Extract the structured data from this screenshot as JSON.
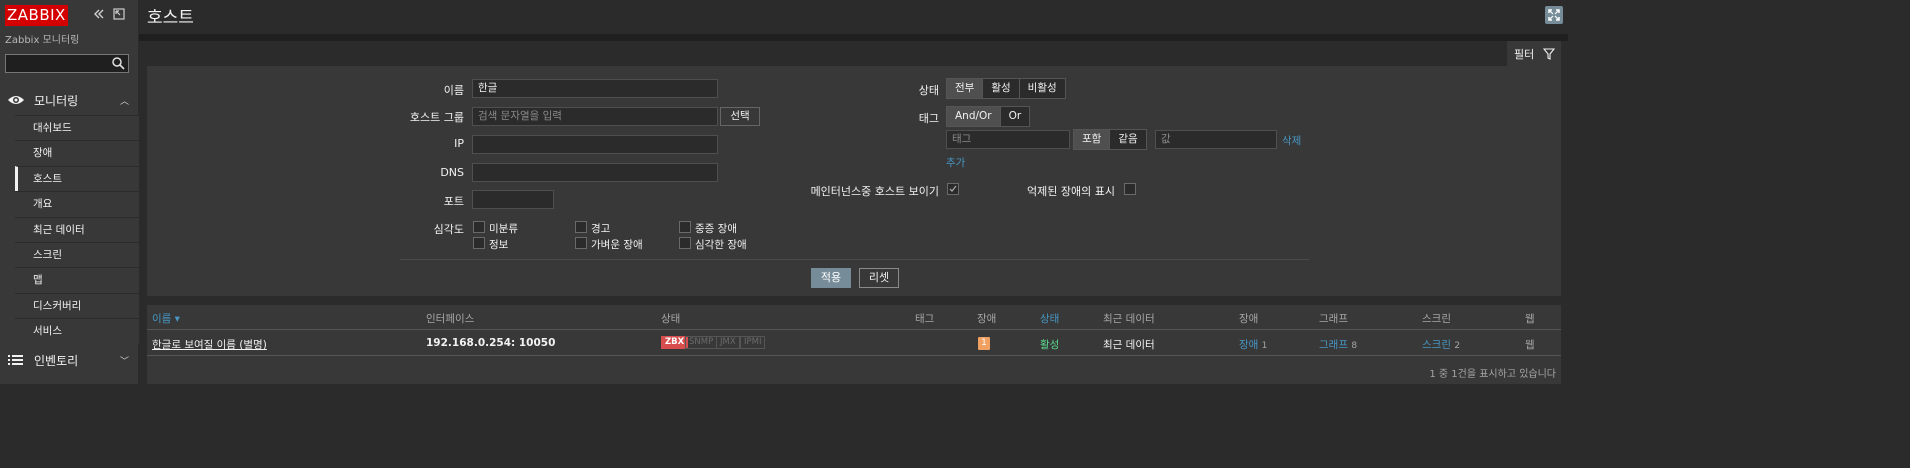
{
  "sidebar": {
    "logo": "ZABBIX",
    "server_name": "Zabbix 모니터링",
    "collapse_icon": "double-chevron-left",
    "kiosk_icon": "expand-window",
    "search_placeholder": "",
    "monitoring": {
      "label": "모니터링",
      "icon": "eye"
    },
    "submenu": [
      {
        "label": "대쉬보드"
      },
      {
        "label": "장애"
      },
      {
        "label": "호스트"
      },
      {
        "label": "개요"
      },
      {
        "label": "최근 데이터"
      },
      {
        "label": "스크린"
      },
      {
        "label": "맵"
      },
      {
        "label": "디스커버리"
      },
      {
        "label": "서비스"
      }
    ],
    "inventory": {
      "label": "인벤토리",
      "icon": "list"
    }
  },
  "header": {
    "title": "호스트",
    "fullscreen_icon": "fullscreen"
  },
  "filter": {
    "tab_label": "필터",
    "name_label": "이름",
    "name_value": "한글",
    "host_group_label": "호스트 그룹",
    "host_group_placeholder": "검색 문자열을 입력",
    "select_button": "선택",
    "ip_label": "IP",
    "dns_label": "DNS",
    "port_label": "포트",
    "severity_label": "심각도",
    "severities": [
      "미분류",
      "경고",
      "중증 장애",
      "정보",
      "가벼운 장애",
      "심각한 장애"
    ],
    "status_label": "상태",
    "status_options": [
      "전부",
      "활성",
      "비활성"
    ],
    "tags_label": "태그",
    "tag_ops": [
      "And/Or",
      "Or"
    ],
    "tag_placeholder": "태그",
    "tag_match": [
      "포함",
      "같음"
    ],
    "value_placeholder": "값",
    "remove_link": "삭제",
    "add_link": "추가",
    "show_maintenance_label": "메인터넌스중 호스트 보이기",
    "show_suppressed_label": "억제된 장애의 표시",
    "apply_button": "적용",
    "reset_button": "리셋"
  },
  "table": {
    "headers": {
      "name": "이름 ▾",
      "interface": "인터페이스",
      "availability": "상태",
      "tags": "태그",
      "problems": "장애",
      "status": "상태",
      "latest": "최근 데이터",
      "problems2": "장애",
      "graphs": "그래프",
      "screens": "스크린",
      "web": "웹"
    },
    "rows": [
      {
        "name": "한글로 보여질 이름 (별명)",
        "interface": "192.168.0.254: 10050",
        "availability": [
          "ZBX",
          "SNMP",
          "JMX",
          "IPMI"
        ],
        "problem_count": "1",
        "status": "활성",
        "latest": "최근 데이터",
        "problems_link": "장애",
        "problems_num": "1",
        "graphs_link": "그래프",
        "graphs_num": "8",
        "screens_link": "스크린",
        "screens_num": "2",
        "web": "웹"
      }
    ],
    "footer": "1 중 1건을 표시하고 있습니다"
  },
  "colors": {
    "bg": "#2b2b2b",
    "panel": "#383838",
    "link": "#4796c4",
    "ok_green": "#59db8f",
    "zbx_red": "#d64e4e",
    "logo_red": "#d40000",
    "accent_button": "#768d99"
  }
}
